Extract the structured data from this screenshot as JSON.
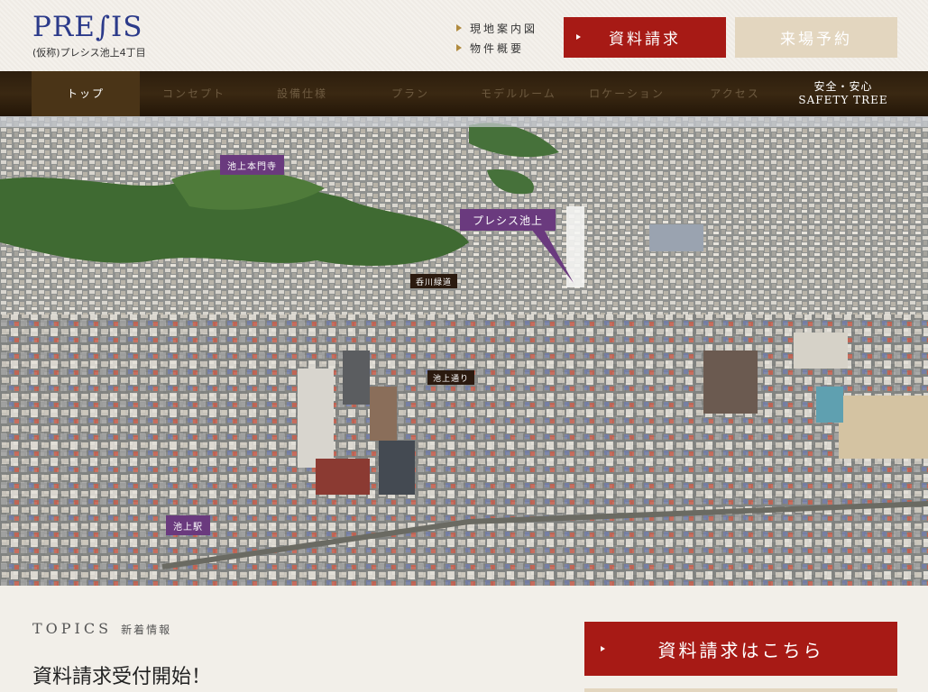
{
  "header": {
    "logo_word": "PRE∫IS",
    "logo_sub": "(仮称)プレシス池上4丁目",
    "util_links": [
      "現地案内図",
      "物件概要"
    ],
    "request_button": "資料請求",
    "visit_button": "来場予約"
  },
  "nav": {
    "items": [
      "トップ",
      "コンセプト",
      "設備仕様",
      "プラン",
      "モデルルーム",
      "ロケーション",
      "アクセス"
    ],
    "safety_line1": "安全・安心",
    "safety_line2": "SAFETY TREE"
  },
  "photo": {
    "labels": {
      "honmonji": "池上本門寺",
      "property": "プレシス池上",
      "kagawa": "呑川緑道",
      "ikegami_dori": "池上通り",
      "station": "池上駅"
    }
  },
  "topics": {
    "title_en": "TOPICS",
    "title_ja": "新着情報",
    "first_item": "資料請求受付開始！"
  },
  "cta": {
    "big_request": "資料請求はこちら"
  },
  "colors": {
    "brand_red": "#a71a15",
    "beige": "#e3d6bf",
    "nav_dark": "#2d1e0d",
    "label_purple": "#6a3a7e",
    "logo_blue": "#2b3a8a"
  }
}
